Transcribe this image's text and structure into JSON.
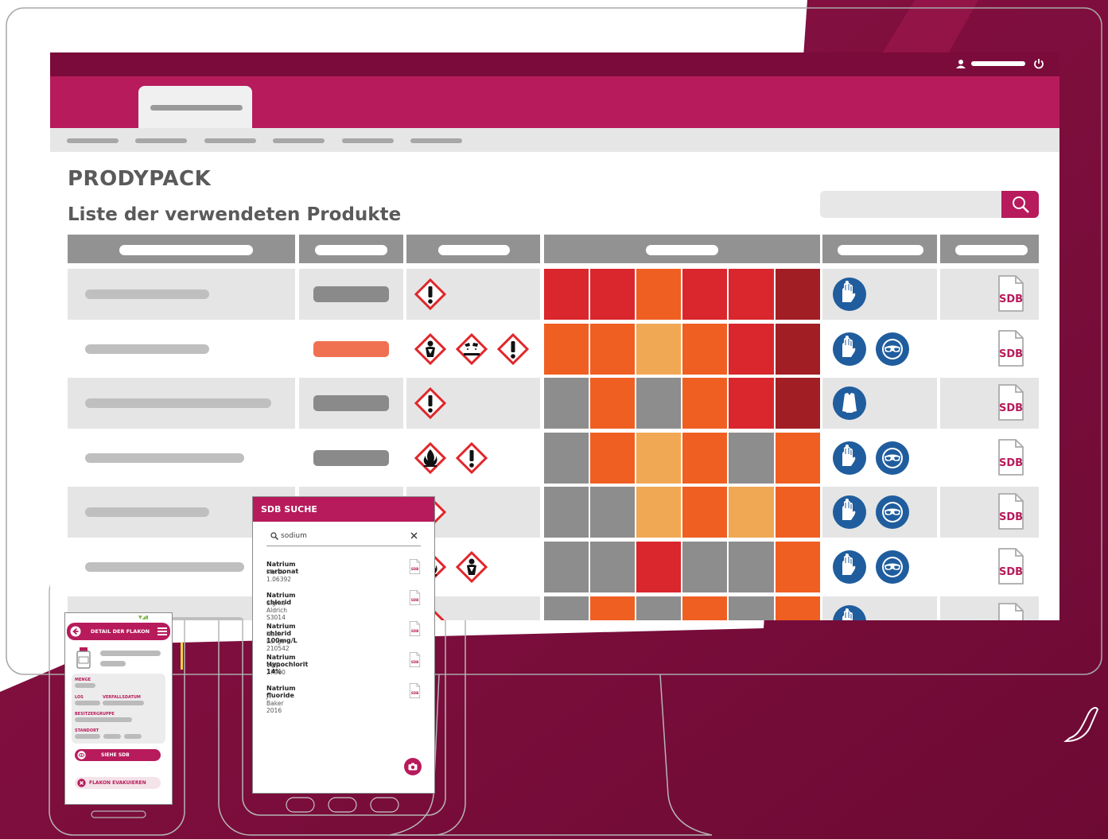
{
  "app": {
    "title": "PRODYPACK",
    "subtitle": "Liste der verwendeten Produkte"
  },
  "table": {
    "rows": [
      {
        "qty_color": "#8a8a8a",
        "hazards": [
          "exclamation-hazard-icon"
        ],
        "risk": [
          "#d9272d",
          "#d9272d",
          "#f05f22",
          "#d9272d",
          "#d9272d",
          "#a21e25"
        ],
        "ppe": [
          "gloves-icon"
        ],
        "sdb": "SDB"
      },
      {
        "qty_color": "#f07052",
        "hazards": [
          "health-hazard-icon",
          "corrosive-hazard-icon",
          "exclamation-hazard-icon"
        ],
        "risk": [
          "#f05f22",
          "#f05f22",
          "#f0a855",
          "#f05f22",
          "#d9272d",
          "#a21e25"
        ],
        "ppe": [
          "gloves-icon",
          "goggles-icon"
        ],
        "sdb": "SDB"
      },
      {
        "qty_color": "#8a8a8a",
        "hazards": [
          "exclamation-hazard-icon"
        ],
        "risk": [
          "#8d8d8d",
          "#f05f22",
          "#8d8d8d",
          "#f05f22",
          "#d9272d",
          "#a21e25"
        ],
        "ppe": [
          "lab-coat-icon"
        ],
        "sdb": "SDB"
      },
      {
        "qty_color": "#8a8a8a",
        "hazards": [
          "flammable-hazard-icon",
          "exclamation-hazard-icon"
        ],
        "risk": [
          "#8d8d8d",
          "#f05f22",
          "#f0a855",
          "#f05f22",
          "#8d8d8d",
          "#f05f22"
        ],
        "ppe": [
          "gloves-icon",
          "goggles-icon"
        ],
        "sdb": "SDB"
      },
      {
        "qty_color": "#8a8a8a",
        "hazards": [
          "exclamation-hazard-icon"
        ],
        "risk": [
          "#8d8d8d",
          "#8d8d8d",
          "#f0a855",
          "#f05f22",
          "#f0a855",
          "#f05f22"
        ],
        "ppe": [
          "gloves-icon",
          "goggles-icon"
        ],
        "sdb": "SDB"
      },
      {
        "qty_color": "#8a8a8a",
        "hazards": [
          "flammable-hazard-icon",
          "health-hazard-icon"
        ],
        "risk": [
          "#8d8d8d",
          "#8d8d8d",
          "#d9272d",
          "#8d8d8d",
          "#8d8d8d",
          "#f05f22"
        ],
        "ppe": [
          "gloves-icon",
          "goggles-icon"
        ],
        "sdb": "SDB"
      },
      {
        "qty_color": "#8a8a8a",
        "hazards": [
          "flammable-hazard-icon"
        ],
        "risk": [
          "#8d8d8d",
          "#f05f22",
          "#8d8d8d",
          "#f05f22",
          "#8d8d8d",
          "#f05f22"
        ],
        "ppe": [
          "gloves-icon"
        ],
        "sdb": "SDB"
      }
    ]
  },
  "tablet": {
    "header": "SDB SUCHE",
    "search_value": "sodium",
    "results": [
      {
        "name": "Natrium carbonat",
        "source": "Merck 1.06392",
        "sdb": "SDB"
      },
      {
        "name": "Natrium chlorid",
        "source": "Sigma-Aldrich S3014",
        "sdb": "SDB"
      },
      {
        "name": "Natrium chlorid 100mg/L",
        "source": "Hach Lange 210542",
        "sdb": "SDB"
      },
      {
        "name": "Natrium Hypochlorit 14%",
        "source": "VWR 27900",
        "sdb": "SDB"
      },
      {
        "name": "Natrium fluoride",
        "source": "JT Baker 2016",
        "sdb": "SDB"
      }
    ]
  },
  "phone": {
    "header": "DETAIL DER FLAKON",
    "labels": {
      "menge": "MENGE",
      "los": "LOS",
      "verfallsdatum": "VERFALLSDATUM",
      "besitzergruppe": "BESITZERGRUPPE",
      "standort": "STANDORT"
    },
    "see_sdb": "SIEHE SDB",
    "evacuate": "FLAKON EVAKUIEREN"
  },
  "colors": {
    "brand_dark": "#7a0b3a",
    "brand": "#b71b5b",
    "header_gray": "#929292"
  }
}
